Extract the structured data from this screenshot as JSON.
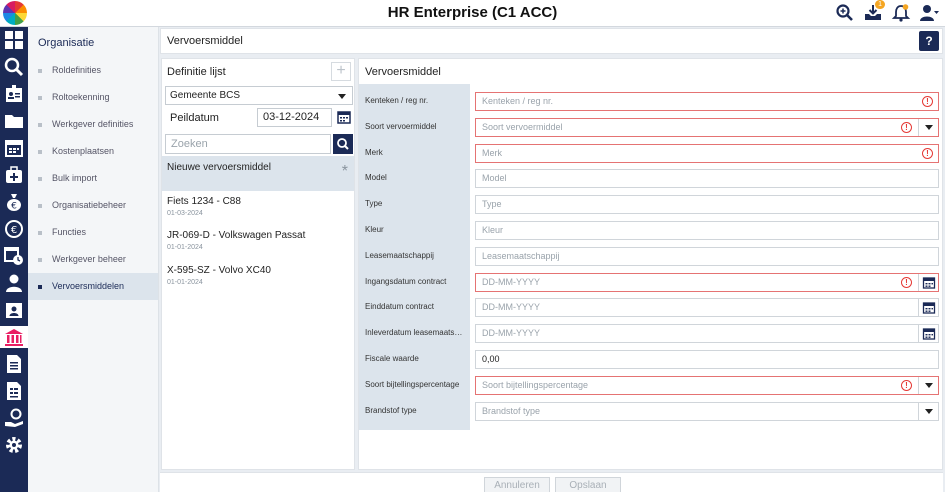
{
  "app": {
    "title": "HR Enterprise (C1 ACC)",
    "notification_badge": "1"
  },
  "submenu": {
    "title": "Organisatie",
    "items": [
      {
        "label": "Roldefinities",
        "active": false
      },
      {
        "label": "Roltoekenning",
        "active": false
      },
      {
        "label": "Werkgever definities",
        "active": false
      },
      {
        "label": "Kostenplaatsen",
        "active": false
      },
      {
        "label": "Bulk import",
        "active": false
      },
      {
        "label": "Organisatiebeheer",
        "active": false
      },
      {
        "label": "Functies",
        "active": false
      },
      {
        "label": "Werkgever beheer",
        "active": false
      },
      {
        "label": "Vervoersmiddelen",
        "active": true
      }
    ]
  },
  "page": {
    "title": "Vervoersmiddel",
    "help_label": "?"
  },
  "list": {
    "title": "Definitie lijst",
    "add_label": "+",
    "employer_select": "Gemeente BCS",
    "peildatum_label": "Peildatum",
    "peildatum_value": "03-12-2024",
    "search_placeholder": "Zoeken",
    "new_item_label": "Nieuwe vervoersmiddel",
    "new_item_marker": "*",
    "items": [
      {
        "title": "Fiets 1234 - C88",
        "date": "01-03-2024"
      },
      {
        "title": "JR-069-D - Volkswagen Passat",
        "date": "01-01-2024"
      },
      {
        "title": "X-595-SZ - Volvo XC40",
        "date": "01-01-2024"
      }
    ]
  },
  "form": {
    "title": "Vervoersmiddel",
    "fields": [
      {
        "label": "Kenteken / reg nr.",
        "placeholder": "Kenteken / reg nr.",
        "value": "",
        "required": true,
        "control": "text"
      },
      {
        "label": "Soort vervoermiddel",
        "placeholder": "Soort vervoermiddel",
        "value": "",
        "required": true,
        "control": "select"
      },
      {
        "label": "Merk",
        "placeholder": "Merk",
        "value": "",
        "required": true,
        "control": "text"
      },
      {
        "label": "Model",
        "placeholder": "Model",
        "value": "",
        "required": false,
        "control": "text"
      },
      {
        "label": "Type",
        "placeholder": "Type",
        "value": "",
        "required": false,
        "control": "text"
      },
      {
        "label": "Kleur",
        "placeholder": "Kleur",
        "value": "",
        "required": false,
        "control": "text"
      },
      {
        "label": "Leasemaatschappij",
        "placeholder": "Leasemaatschappij",
        "value": "",
        "required": false,
        "control": "text"
      },
      {
        "label": "Ingangsdatum contract",
        "placeholder": "DD-MM-YYYY",
        "value": "",
        "required": true,
        "control": "date"
      },
      {
        "label": "Einddatum contract",
        "placeholder": "DD-MM-YYYY",
        "value": "",
        "required": false,
        "control": "date"
      },
      {
        "label": "Inleverdatum leasemaatsc...",
        "placeholder": "DD-MM-YYYY",
        "value": "",
        "required": false,
        "control": "date"
      },
      {
        "label": "Fiscale waarde",
        "placeholder": "",
        "value": "0,00",
        "required": false,
        "control": "text"
      },
      {
        "label": "Soort bijtellingspercentage",
        "placeholder": "Soort bijtellingspercentage",
        "value": "",
        "required": true,
        "control": "select"
      },
      {
        "label": "Brandstof type",
        "placeholder": "Brandstof type",
        "value": "",
        "required": false,
        "control": "select"
      }
    ]
  },
  "footer": {
    "cancel_label": "Annuleren",
    "save_label": "Opslaan"
  },
  "colors": {
    "navy": "#1b2a56",
    "error": "#e53935",
    "accent_orange": "#f5a623",
    "active_rail_icon": "#e91e63"
  }
}
